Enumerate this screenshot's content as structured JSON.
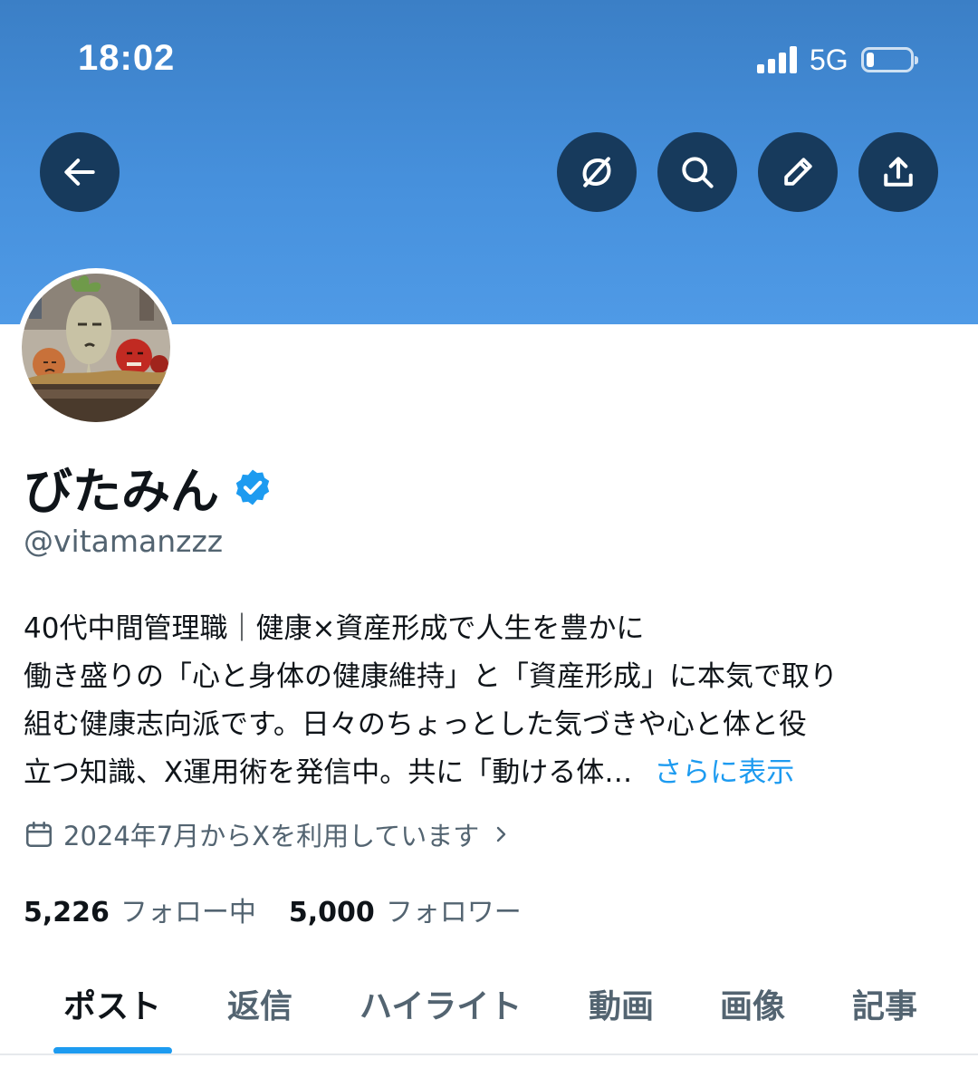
{
  "status_bar": {
    "time": "18:02",
    "network": "5G",
    "signal_bars": 4,
    "battery_level": 0.1
  },
  "header_buttons": {
    "back": "arrow-left-icon",
    "grok": "grok-icon",
    "search": "search-icon",
    "edit": "pencil-icon",
    "share": "share-icon"
  },
  "profile": {
    "display_name": "びたみん",
    "verified": true,
    "handle": "@vitamanzzz",
    "bio_lines": [
      "40代中間管理職｜健康×資産形成で人生を豊かに",
      "働き盛りの「心と身体の健康維持」と「資産形成」に本気で取り",
      "組む健康志向派です。日々のちょっとした気づきや心と体と役",
      "立つ知識、X運用術を発信中。共に「動ける体…"
    ],
    "show_more": "さらに表示",
    "joined": "2024年7月からXを利用しています",
    "following_count": "5,226",
    "following_label": "フォロー中",
    "followers_count": "5,000",
    "followers_label": "フォロワー"
  },
  "tabs": [
    {
      "label": "ポスト",
      "active": true
    },
    {
      "label": "返信",
      "active": false
    },
    {
      "label": "ハイライト",
      "active": false
    },
    {
      "label": "動画",
      "active": false
    },
    {
      "label": "画像",
      "active": false
    },
    {
      "label": "記事",
      "active": false
    }
  ],
  "colors": {
    "banner": "#4690dc",
    "button_bg": "#173a5c",
    "accent": "#1d9bf0",
    "text_primary": "#0f1419",
    "text_secondary": "#536471"
  }
}
